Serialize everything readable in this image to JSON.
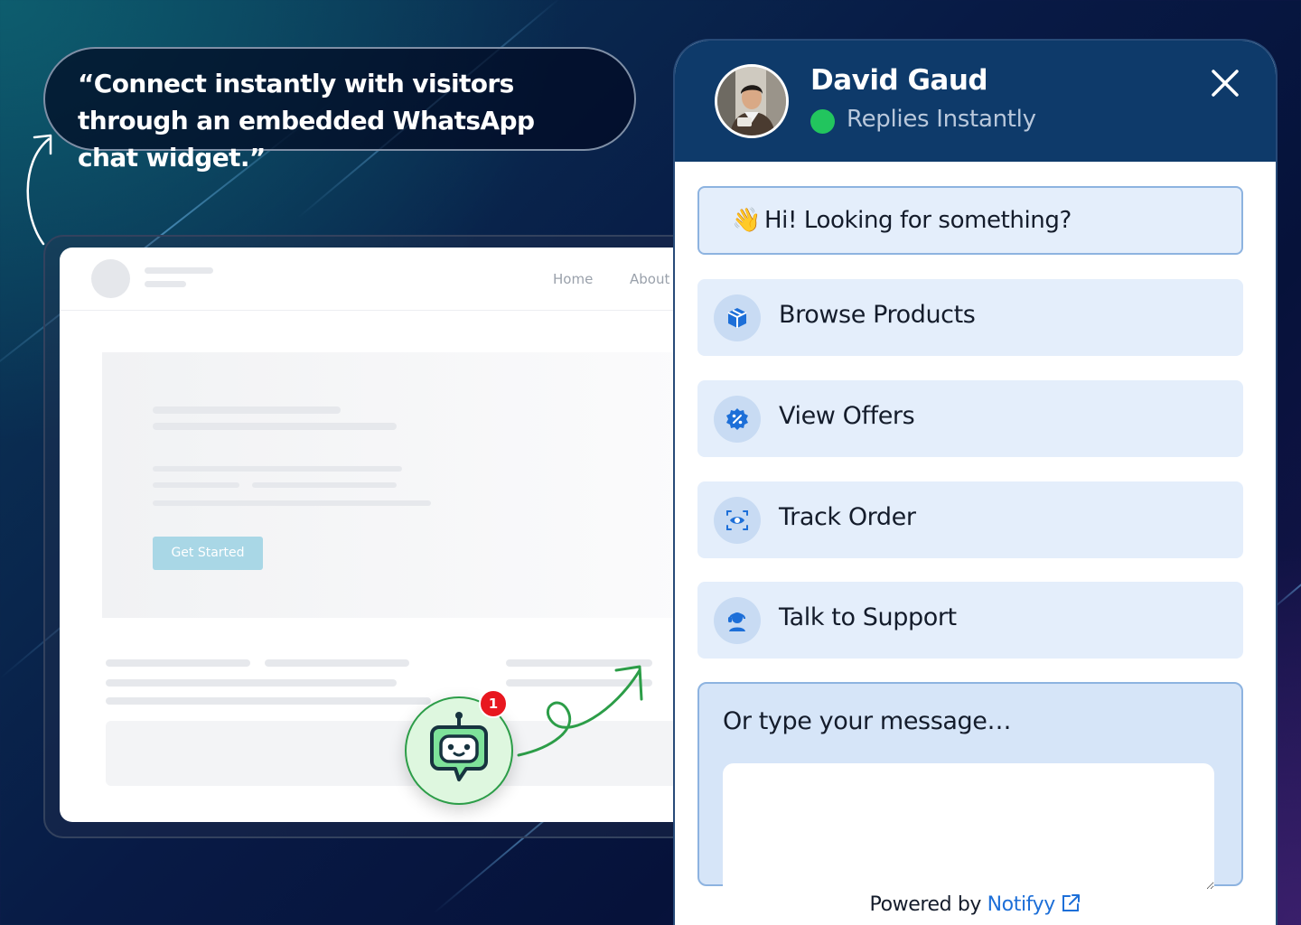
{
  "quote": {
    "text": "“Connect instantly with visitors through an embedded WhatsApp chat widget.”"
  },
  "website": {
    "nav": [
      "Home",
      "About"
    ],
    "cta_label": "Get Started"
  },
  "launcher": {
    "badge_count": "1",
    "icon": "chat-bot-icon"
  },
  "widget": {
    "agent_name": "David Gaud",
    "status_text": "Replies Instantly",
    "status_color": "#22c55e",
    "greeting_emoji": "👋",
    "greeting": "Hi! Looking for something?",
    "options": [
      {
        "label": "Browse Products",
        "icon": "package-icon"
      },
      {
        "label": "View Offers",
        "icon": "discount-badge-icon"
      },
      {
        "label": "Track Order",
        "icon": "eye-scan-icon"
      },
      {
        "label": "Talk to Support",
        "icon": "support-agent-icon"
      }
    ],
    "message_label": "Or type your message…",
    "powered_prefix": "Powered by",
    "powered_brand": "Notifyy",
    "accent": "#1d6fd8",
    "header_color": "#0e3a6a"
  }
}
